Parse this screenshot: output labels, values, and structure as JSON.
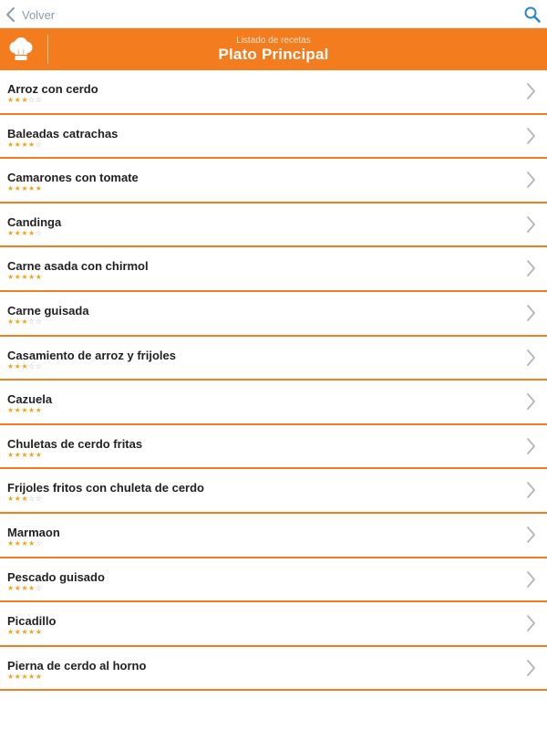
{
  "nav": {
    "back_label": "Volver"
  },
  "header": {
    "subtitle": "Listado de recetas",
    "title": "Plato Principal"
  },
  "colors": {
    "accent": "#f37c1e",
    "star": "#f3a21e",
    "star_empty": "#b8b8b8",
    "nav_icon": "#8a9aac",
    "search_icon": "#2a86c4"
  },
  "icons": {
    "back": "chevron-left-icon",
    "search": "search-icon",
    "logo": "chef-hat-icon",
    "row": "chevron-right-icon"
  },
  "recipes": [
    {
      "name": "Arroz con cerdo",
      "rating": 3,
      "max": 5
    },
    {
      "name": "Baleadas catrachas",
      "rating": 4,
      "max": 5
    },
    {
      "name": "Camarones con tomate",
      "rating": 5,
      "max": 5
    },
    {
      "name": "Candinga",
      "rating": 4,
      "max": 5
    },
    {
      "name": "Carne asada con chirmol",
      "rating": 5,
      "max": 5
    },
    {
      "name": "Carne guisada",
      "rating": 3,
      "max": 5
    },
    {
      "name": "Casamiento de arroz y frijoles",
      "rating": 3,
      "max": 5
    },
    {
      "name": "Cazuela",
      "rating": 5,
      "max": 5
    },
    {
      "name": "Chuletas de cerdo fritas",
      "rating": 5,
      "max": 5
    },
    {
      "name": "Frijoles fritos con chuleta de cerdo",
      "rating": 3,
      "max": 5
    },
    {
      "name": "Marmaon",
      "rating": 4,
      "max": 5
    },
    {
      "name": "Pescado guisado",
      "rating": 4,
      "max": 5
    },
    {
      "name": "Picadillo",
      "rating": 5,
      "max": 5
    },
    {
      "name": "Pierna de cerdo al horno",
      "rating": 5,
      "max": 5
    }
  ]
}
